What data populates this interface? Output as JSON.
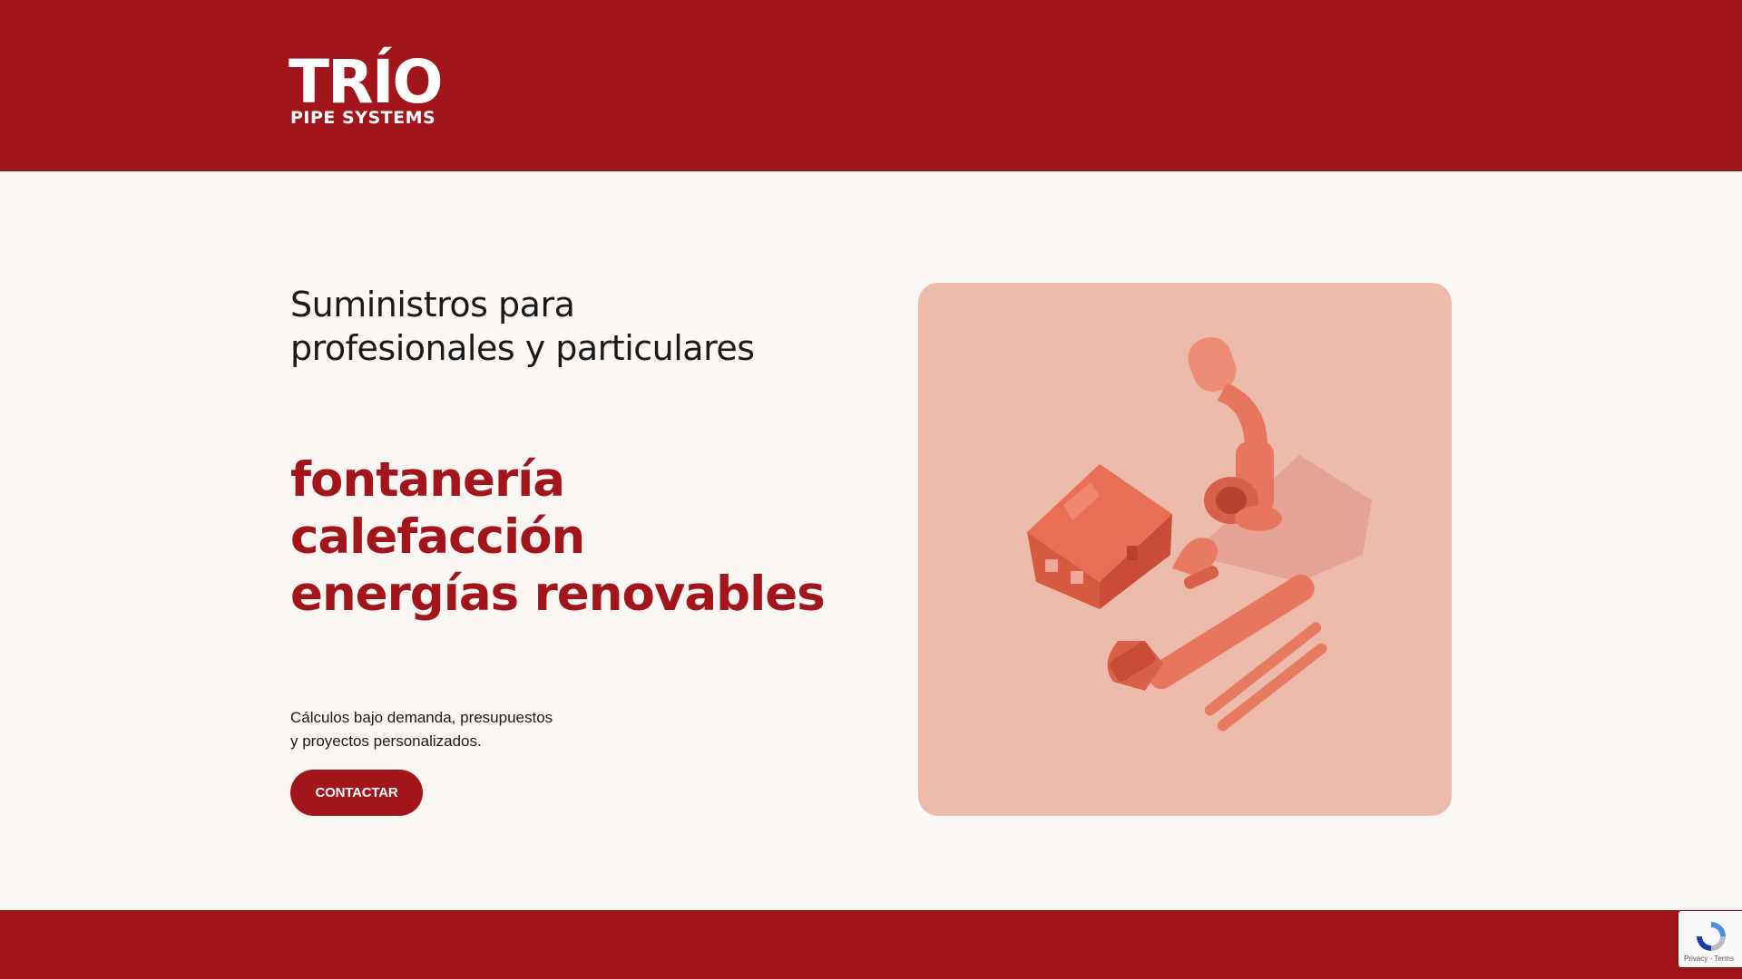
{
  "header": {
    "logo_main": "TRÍO",
    "logo_sub": "PIPE SYSTEMS",
    "background_color": "#a2151a"
  },
  "hero": {
    "title_line1": "Suministros para",
    "title_line2": "profesionales y particulares",
    "services": [
      "fontanería",
      "calefacción",
      "energías renovables"
    ],
    "description_line1": "Cálculos bajo demanda, presupuestos",
    "description_line2": "y proyectos personalizados.",
    "cta_label": "CONTACTAR",
    "accent_color": "#a2151a",
    "image_background_color": "#edbbac",
    "image_icons": [
      "house-model-icon",
      "pipe-fitting-icon",
      "pipe-wrench-icon",
      "pipe-segment-icon"
    ]
  },
  "recaptcha": {
    "label": "Privacy - Terms",
    "icon": "recaptcha-icon"
  }
}
